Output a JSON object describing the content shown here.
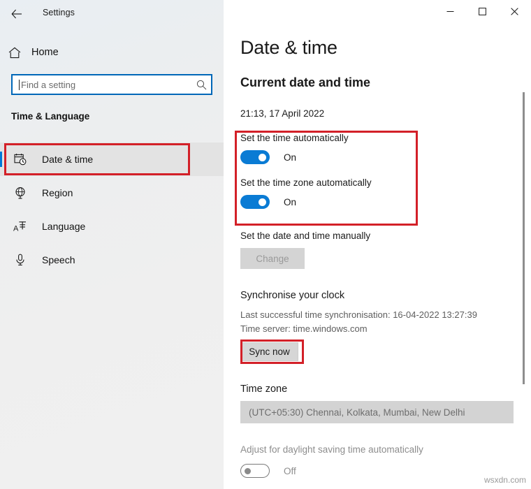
{
  "window": {
    "title": "Settings",
    "back_label": "back-arrow",
    "minimize_label": "–",
    "maximize_label": "☐",
    "close_label": "✕"
  },
  "sidebar": {
    "home_label": "Home",
    "search": {
      "placeholder": "Find a setting",
      "value": ""
    },
    "category": "Time & Language",
    "items": [
      {
        "label": "Date & time",
        "icon": "calendar-clock-icon",
        "selected": true
      },
      {
        "label": "Region",
        "icon": "globe-icon",
        "selected": false
      },
      {
        "label": "Language",
        "icon": "language-icon",
        "selected": false
      },
      {
        "label": "Speech",
        "icon": "microphone-icon",
        "selected": false
      }
    ]
  },
  "main": {
    "page_title": "Date & time",
    "current_section_heading": "Current date and time",
    "current_datetime": "21:13, 17 April 2022",
    "set_time_auto": {
      "label": "Set the time automatically",
      "state": "On",
      "on": true
    },
    "set_timezone_auto": {
      "label": "Set the time zone automatically",
      "state": "On",
      "on": true
    },
    "manual": {
      "label": "Set the date and time manually",
      "button_label": "Change",
      "disabled": true
    },
    "sync": {
      "heading": "Synchronise your clock",
      "last_sync": "Last successful time synchronisation: 16-04-2022 13:27:39",
      "time_server": "Time server: time.windows.com",
      "button_label": "Sync now"
    },
    "timezone": {
      "heading": "Time zone",
      "value": "(UTC+05:30) Chennai, Kolkata, Mumbai, New Delhi"
    },
    "dst": {
      "label": "Adjust for daylight saving time automatically",
      "state": "Off",
      "on": false
    }
  },
  "annotations": {
    "color": "#d32028",
    "boxes": [
      "date-time-nav-item",
      "automatic-time-toggles",
      "sync-now-button"
    ]
  },
  "watermark": "wsxdn.com",
  "colors": {
    "accent_blue": "#0078d7",
    "toggle_blue": "#0a7bd4",
    "search_border": "#0067b8",
    "annotation_red": "#d32028"
  }
}
